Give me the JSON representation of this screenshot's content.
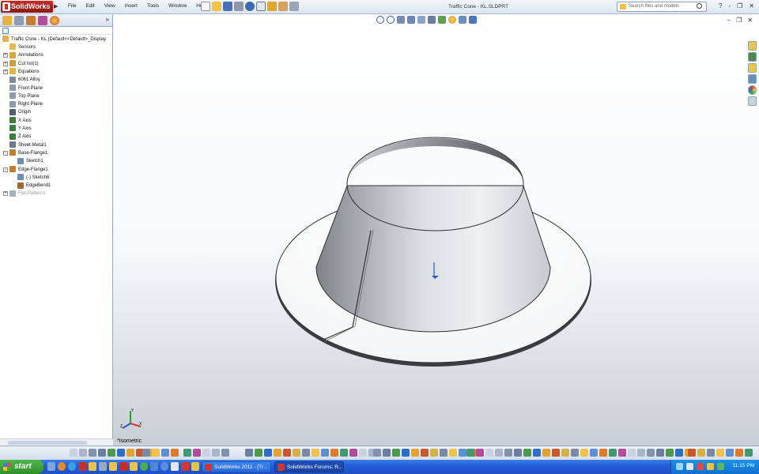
{
  "app": {
    "brand": "SolidWorks",
    "menu": [
      "File",
      "Edit",
      "View",
      "Insert",
      "Tools",
      "Window",
      "Help"
    ],
    "document_title": "Traffic Cone - KL.SLDPRT",
    "search_placeholder": "Search files and models",
    "window_controls": [
      "?",
      "-",
      "❐",
      "✕"
    ]
  },
  "feature_tree": {
    "root": "Traffic Cone - KL  (Default<<Default>_Display",
    "items": [
      {
        "label": "Sensors",
        "icon": "sensors-icon",
        "expander": "",
        "indent": 0,
        "color": "#e8b84a"
      },
      {
        "label": "Annotations",
        "icon": "annotations-icon",
        "expander": "+",
        "indent": 0,
        "color": "#d9a73a"
      },
      {
        "label": "Cut list(1)",
        "icon": "cut-list-icon",
        "expander": "+",
        "indent": 0,
        "color": "#c9a23b"
      },
      {
        "label": "Equations",
        "icon": "equations-icon",
        "expander": "+",
        "indent": 0,
        "color": "#e0b640"
      },
      {
        "label": "6061 Alloy",
        "icon": "material-icon",
        "expander": "",
        "indent": 0,
        "color": "#7d8a9c"
      },
      {
        "label": "Front Plane",
        "icon": "plane-icon",
        "expander": "",
        "indent": 0,
        "color": "#8f9aaa"
      },
      {
        "label": "Top Plane",
        "icon": "plane-icon",
        "expander": "",
        "indent": 0,
        "color": "#8f9aaa"
      },
      {
        "label": "Right Plane",
        "icon": "plane-icon",
        "expander": "",
        "indent": 0,
        "color": "#8f9aaa"
      },
      {
        "label": "Origin",
        "icon": "origin-icon",
        "expander": "",
        "indent": 0,
        "color": "#555c6a"
      },
      {
        "label": "X Axis",
        "icon": "axis-icon",
        "expander": "",
        "indent": 0,
        "color": "#3c7d3c"
      },
      {
        "label": "Y Axis",
        "icon": "axis-icon",
        "expander": "",
        "indent": 0,
        "color": "#3c7d3c"
      },
      {
        "label": "Z Axis",
        "icon": "axis-icon",
        "expander": "",
        "indent": 0,
        "color": "#3c7d3c"
      },
      {
        "label": "Sheet-Metal1",
        "icon": "sheet-metal-icon",
        "expander": "",
        "indent": 0,
        "color": "#6d7a8d"
      },
      {
        "label": "Base-Flange1",
        "icon": "base-flange-icon",
        "expander": "-",
        "indent": 0,
        "color": "#c47f2d"
      },
      {
        "label": "Sketch1",
        "icon": "sketch-icon",
        "expander": "",
        "indent": 1,
        "color": "#6f8fb0"
      },
      {
        "label": "Edge-Flange1",
        "icon": "edge-flange-icon",
        "expander": "-",
        "indent": 0,
        "color": "#c47f2d"
      },
      {
        "label": "(-) Sketch6",
        "icon": "sketch-icon",
        "expander": "",
        "indent": 1,
        "color": "#6f8fb0"
      },
      {
        "label": "EdgeBend1",
        "icon": "edge-bend-icon",
        "expander": "",
        "indent": 1,
        "color": "#a06a2a"
      },
      {
        "label": "Flat-Pattern1",
        "icon": "flat-pattern-icon",
        "expander": "+",
        "indent": 0,
        "color": "#a9b1bd",
        "dim": true
      }
    ]
  },
  "viewport": {
    "view_label": "*Isometric",
    "triad_axes": [
      "X",
      "Y",
      "Z"
    ]
  },
  "taskbar": {
    "start_label": "start",
    "tasks": [
      {
        "label": "SolidWorks 2011 - [Tr...",
        "active": false
      },
      {
        "label": "SolidWorks Forums: R...",
        "active": true
      }
    ],
    "clock": "11:15 PM"
  },
  "colors": {
    "accent": "#245edb",
    "brand_red": "#c92b22",
    "model_gray": "#a9adb2"
  }
}
